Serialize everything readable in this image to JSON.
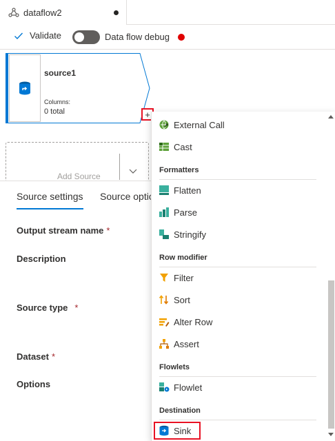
{
  "tab": {
    "title": "dataflow2"
  },
  "toolbar": {
    "validate_label": "Validate",
    "debug_label": "Data flow debug"
  },
  "node": {
    "title": "source1",
    "columns_label": "Columns:",
    "columns_value": "0 total"
  },
  "add_source": {
    "label": "Add Source"
  },
  "panel": {
    "tabs": [
      "Source settings",
      "Source optio"
    ],
    "fields": [
      "Output stream name",
      "Description",
      "Source type",
      "Dataset",
      "Options"
    ]
  },
  "menu": {
    "items_top": [
      "External Call",
      "Cast"
    ],
    "sections": [
      {
        "title": "Formatters",
        "items": [
          "Flatten",
          "Parse",
          "Stringify"
        ]
      },
      {
        "title": "Row modifier",
        "items": [
          "Filter",
          "Sort",
          "Alter Row",
          "Assert"
        ]
      },
      {
        "title": "Flowlets",
        "items": [
          "Flowlet"
        ]
      },
      {
        "title": "Destination",
        "items": [
          "Sink"
        ]
      }
    ]
  },
  "colors": {
    "accent": "#0078d4",
    "highlight": "#e81123",
    "debug_dot": "#e00000"
  },
  "icons": [
    "dataflow-icon",
    "check-icon",
    "source-cylinder-icon",
    "plus-icon",
    "chevron-down-icon",
    "external-call-icon",
    "cast-icon",
    "flatten-icon",
    "parse-icon",
    "stringify-icon",
    "filter-icon",
    "sort-icon",
    "alter-row-icon",
    "assert-icon",
    "flowlet-icon",
    "sink-icon"
  ]
}
